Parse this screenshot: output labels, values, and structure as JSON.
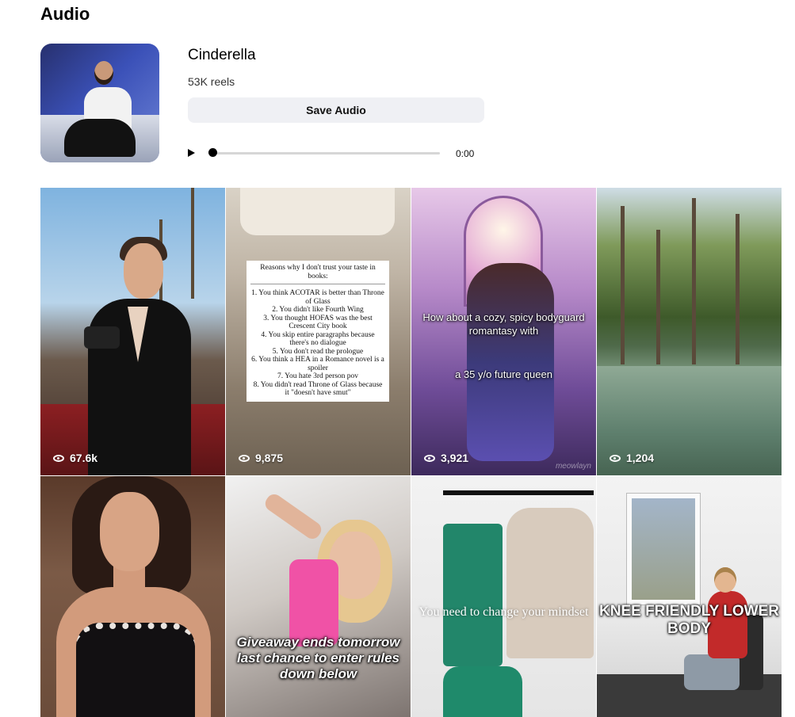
{
  "page": {
    "heading": "Audio"
  },
  "audio": {
    "title": "Cinderella",
    "reels_count": "53K reels",
    "save_label": "Save Audio",
    "player": {
      "time": "0:00",
      "progress": 0
    }
  },
  "reels": [
    {
      "views": "67.6k"
    },
    {
      "views": "9,875",
      "overlay_title": "Reasons why I don't trust your taste in books:",
      "overlay_list": "1. You think ACOTAR is better than Throne of Glass\n2. You didn't like Fourth Wing\n3. You thought HOFAS was the best Crescent City book\n4. You skip entire paragraphs because there's no dialogue\n5. You don't read the prologue\n6. You think a HEA in a Romance novel is a spoiler\n7. You hate 3rd person pov\n8. You didn't read Throne of Glass because it \"doesn't have smut\""
    },
    {
      "views": "3,921",
      "overlay_text": "How about a cozy, spicy bodyguard romantasy with",
      "overlay_text_2": "a 35 y/o future queen",
      "watermark": "meowlayn"
    },
    {
      "views": "1,204"
    },
    {
      "views": ""
    },
    {
      "overlay_text": "Giveaway ends tomorrow last chance to enter rules down below"
    },
    {
      "overlay_text": "You need to change your mindset"
    },
    {
      "overlay_text": "KNEE FRIENDLY LOWER BODY"
    }
  ],
  "colors": {
    "button_bg": "#eff0f4",
    "overlay_text": "#ffffff"
  }
}
